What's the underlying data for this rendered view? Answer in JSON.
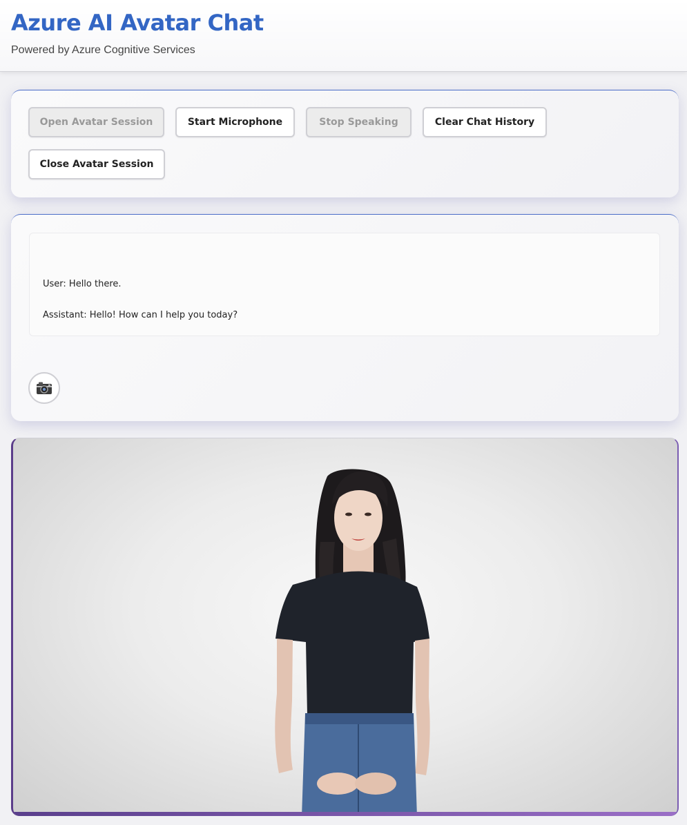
{
  "header": {
    "title": "Azure AI Avatar Chat",
    "subtitle": "Powered by Azure Cognitive Services"
  },
  "controls": {
    "open_session": "Open Avatar Session",
    "start_microphone": "Start Microphone",
    "stop_speaking": "Stop Speaking",
    "clear_history": "Clear Chat History",
    "close_session": "Close Avatar Session"
  },
  "chat": {
    "messages": [
      "User: Hello there.",
      "Assistant: Hello! How can I help you today?"
    ],
    "camera_icon": "camera-icon"
  },
  "avatar": {
    "description_icon": "avatar-video"
  },
  "colors": {
    "title": "#3366c4",
    "accent": "#4a6cc7",
    "video_border": "#5b3d8a"
  }
}
